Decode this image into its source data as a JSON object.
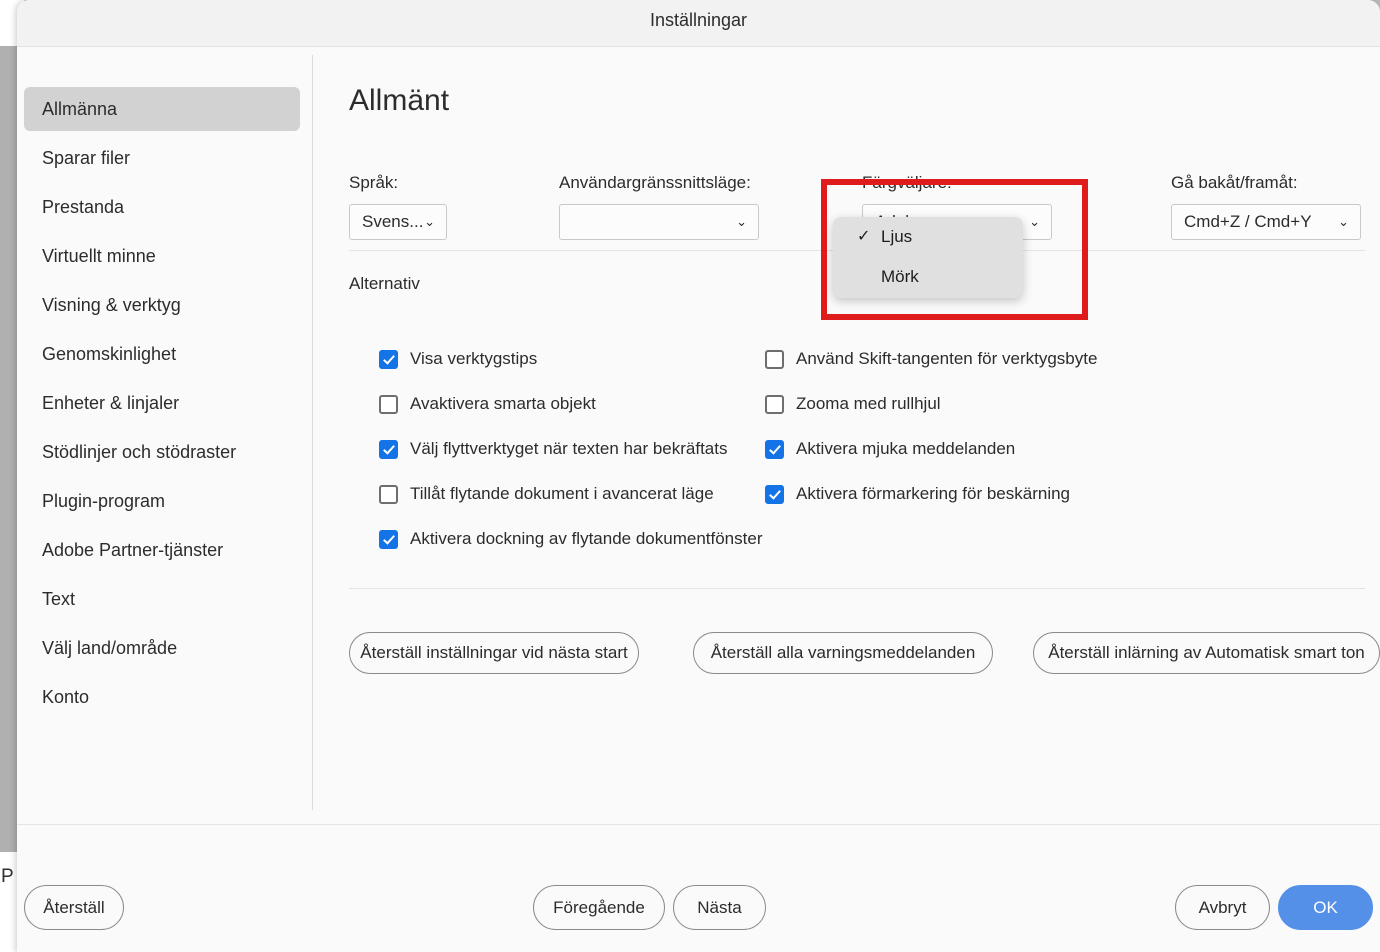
{
  "window": {
    "title": "Inställningar",
    "background_window_label": "P"
  },
  "sidebar": {
    "items": [
      {
        "label": "Allmänna",
        "selected": true
      },
      {
        "label": "Sparar filer",
        "selected": false
      },
      {
        "label": "Prestanda",
        "selected": false
      },
      {
        "label": "Virtuellt minne",
        "selected": false
      },
      {
        "label": "Visning & verktyg",
        "selected": false
      },
      {
        "label": "Genomskinlighet",
        "selected": false
      },
      {
        "label": "Enheter & linjaler",
        "selected": false
      },
      {
        "label": "Stödlinjer och stödraster",
        "selected": false
      },
      {
        "label": "Plugin-program",
        "selected": false
      },
      {
        "label": "Adobe Partner-tjänster",
        "selected": false
      },
      {
        "label": "Text",
        "selected": false
      },
      {
        "label": "Välj land/område",
        "selected": false
      },
      {
        "label": "Konto",
        "selected": false
      }
    ]
  },
  "main": {
    "page_title": "Allmänt",
    "fields": [
      {
        "label": "Språk:",
        "value": "Svens..."
      },
      {
        "label": "Användargränssnittsläge:",
        "value": ""
      },
      {
        "label": "Färgväljare:",
        "value": "Adobe"
      },
      {
        "label": "Gå bakåt/framåt:",
        "value": "Cmd+Z / Cmd+Y"
      }
    ],
    "options_label": "Alternativ",
    "checkboxes_left": [
      {
        "label": "Visa verktygstips",
        "checked": true
      },
      {
        "label": "Avaktivera smarta objekt",
        "checked": false
      },
      {
        "label": "Välj flyttverktyget när texten har bekräftats",
        "checked": true
      },
      {
        "label": "Tillåt flytande dokument i avancerat läge",
        "checked": false
      },
      {
        "label": "Aktivera dockning av flytande dokumentfönster",
        "checked": true
      }
    ],
    "checkboxes_right": [
      {
        "label": "Använd Skift-tangenten för verktygsbyte",
        "checked": false
      },
      {
        "label": "Zooma med rullhjul",
        "checked": false
      },
      {
        "label": "Aktivera mjuka meddelanden",
        "checked": true
      },
      {
        "label": "Aktivera förmarkering för beskärning",
        "checked": true
      }
    ],
    "reset_buttons": [
      "Återställ inställningar vid nästa start",
      "Återställ alla varningsmeddelanden",
      "Återställ inlärning av Automatisk smart ton"
    ]
  },
  "dropdown": {
    "open": true,
    "items": [
      {
        "label": "Ljus",
        "checked": true,
        "check_glyph": "✓"
      },
      {
        "label": "Mörk",
        "checked": false,
        "check_glyph": ""
      }
    ],
    "highlight_color": "#e01b1b"
  },
  "footer": {
    "reset": "Återställ",
    "previous": "Föregående",
    "next": "Nästa",
    "cancel": "Avbryt",
    "ok": "OK"
  },
  "icons": {
    "chevron_down": "⌄"
  },
  "colors": {
    "accent_checkbox": "#1473e6",
    "cta_button": "#5590e8",
    "selected_nav": "#d2d2d2",
    "highlight": "#e01b1b"
  }
}
